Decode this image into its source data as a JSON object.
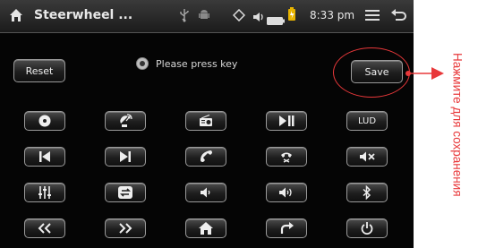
{
  "statusbar": {
    "title": "Steerwheel ...",
    "time": "8:33 pm",
    "icons": [
      "home-icon",
      "usb-icon",
      "android-icon",
      "gps-icon",
      "volume-icon",
      "battery-icon",
      "charging-icon",
      "menu-icon",
      "back-icon"
    ]
  },
  "controls": {
    "reset_label": "Reset",
    "save_label": "Save",
    "prompt_text": "Please press key"
  },
  "grid": {
    "rows": [
      [
        "disc-icon",
        "satellite-icon",
        "radio-icon",
        "play-pause-icon",
        "LUD"
      ],
      [
        "previous-icon",
        "next-icon",
        "phone-answer-icon",
        "phone-hangup-icon",
        "mute-icon"
      ],
      [
        "equalizer-icon",
        "switch-icon",
        "volume-down-icon",
        "volume-up-icon",
        "bluetooth-icon"
      ],
      [
        "rewind-icon",
        "fast-forward-icon",
        "home-icon",
        "return-icon",
        "power-icon"
      ]
    ],
    "text_button_label": "LUD"
  },
  "annotation": {
    "text": "Нажмите для сохранения",
    "color": "#e8383a"
  },
  "colors": {
    "background": "#050505",
    "accent": "#e8383a"
  }
}
